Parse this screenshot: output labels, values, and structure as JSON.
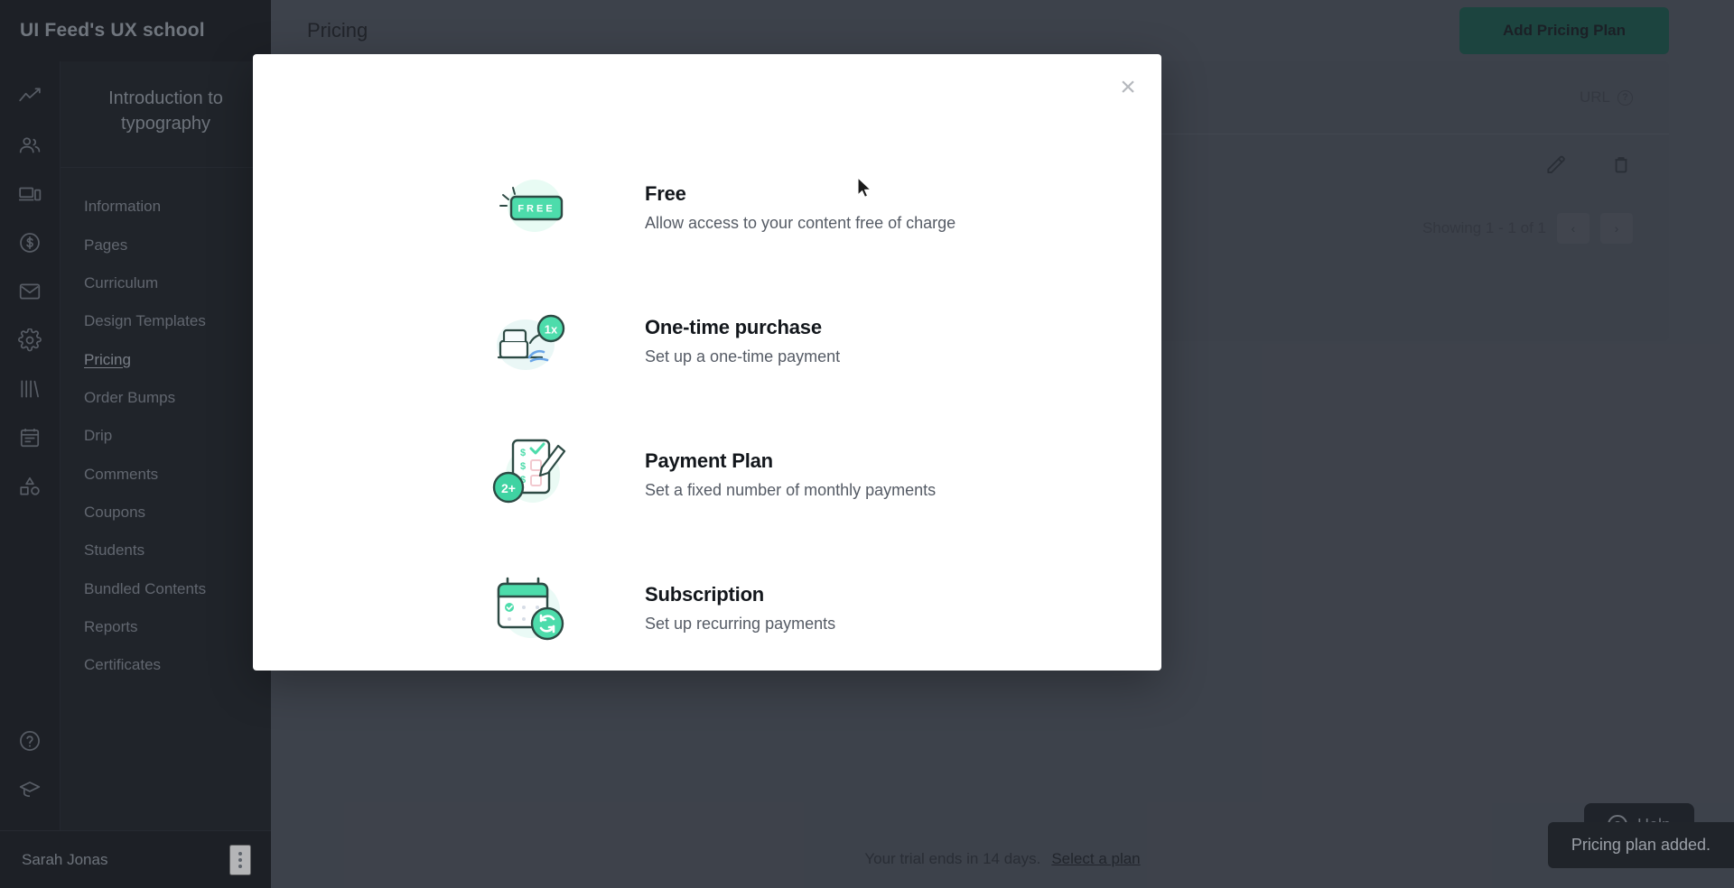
{
  "sidebar": {
    "brand": "UI Feed's UX school",
    "course_title": "Introduction to typography",
    "rail_icons": [
      "analytics-icon",
      "users-icon",
      "devices-icon",
      "dollar-circle-icon",
      "mail-icon",
      "gear-icon",
      "library-icon",
      "calendar-list-icon",
      "shapes-icon",
      "help-circle-icon",
      "graduation-cap-icon"
    ],
    "items": [
      {
        "label": "Information",
        "active": false
      },
      {
        "label": "Pages",
        "active": false
      },
      {
        "label": "Curriculum",
        "active": false
      },
      {
        "label": "Design Templates",
        "active": false
      },
      {
        "label": "Pricing",
        "active": true
      },
      {
        "label": "Order Bumps",
        "active": false
      },
      {
        "label": "Drip",
        "active": false
      },
      {
        "label": "Comments",
        "active": false
      },
      {
        "label": "Coupons",
        "active": false
      },
      {
        "label": "Students",
        "active": false
      },
      {
        "label": "Bundled Contents",
        "active": false
      },
      {
        "label": "Reports",
        "active": false
      },
      {
        "label": "Certificates",
        "active": false
      }
    ],
    "user_name": "Sarah Jonas"
  },
  "header": {
    "title": "Pricing",
    "add_button": "Add Pricing Plan"
  },
  "table": {
    "url_header": "URL",
    "pagination_text": "Showing 1 - 1 of 1",
    "prev_label": "‹",
    "next_label": "›"
  },
  "modal": {
    "close_label": "×",
    "plans": [
      {
        "name": "Free",
        "description": "Allow access to your content free of charge",
        "icon": "free-tag-icon"
      },
      {
        "name": "One-time purchase",
        "description": "Set up a one-time payment",
        "icon": "one-time-purchase-icon"
      },
      {
        "name": "Payment Plan",
        "description": "Set a fixed number of monthly payments",
        "icon": "payment-plan-icon"
      },
      {
        "name": "Subscription",
        "description": "Set up recurring payments",
        "icon": "subscription-calendar-icon"
      }
    ]
  },
  "footer": {
    "trial_text": "Your trial ends in 14 days.",
    "trial_link": "Select a plan",
    "help_label": "Help",
    "toast": "Pricing plan added."
  },
  "colors": {
    "accent_green": "#4ddcab",
    "dark_bg": "#1e2126",
    "main_bg": "#4a4f59",
    "button_green": "#1d5248"
  }
}
